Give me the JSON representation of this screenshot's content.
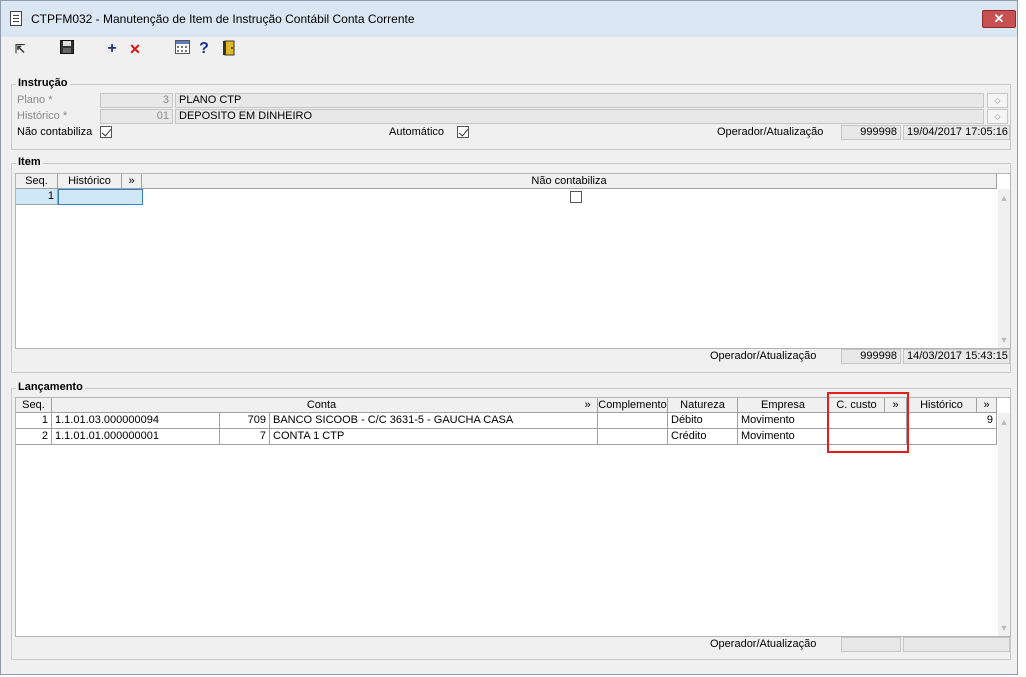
{
  "window": {
    "title": "CTPFM032 - Manutenção de Item de Instrução Contábil Conta Corrente",
    "close_glyph": "✕"
  },
  "toolbar": {
    "items": [
      {
        "name": "select-icon",
        "glyph": "⇱"
      },
      {
        "name": "save-icon",
        "glyph": "💾"
      },
      {
        "name": "add-icon",
        "glyph": "+"
      },
      {
        "name": "delete-icon",
        "glyph": "✕"
      },
      {
        "name": "calculator-icon",
        "glyph": "▦"
      },
      {
        "name": "help-icon",
        "glyph": "?"
      },
      {
        "name": "exit-icon",
        "glyph": "⎘"
      }
    ]
  },
  "instrucao": {
    "title": "Instrução",
    "plano_label": "Plano *",
    "plano_code": "3",
    "plano_desc": "PLANO CTP",
    "historico_label": "Histórico *",
    "historico_code": "01",
    "historico_desc": "DEPOSITO EM DINHEIRO",
    "nao_contabiliza_label": "Não contabiliza",
    "nao_contabiliza_checked": true,
    "automatico_label": "Automático",
    "automatico_checked": true,
    "operador_label": "Operador/Atualização",
    "operador": "999998",
    "atualizacao": "19/04/2017 17:05:16"
  },
  "item": {
    "title": "Item",
    "columns": {
      "seq": "Seq.",
      "historico": "Histórico",
      "expand": "»",
      "nao_contabiliza": "Não contabiliza"
    },
    "rows": [
      {
        "seq": "1",
        "historico": "",
        "nao_contabiliza": false
      }
    ],
    "operador_label": "Operador/Atualização",
    "operador": "999998",
    "atualizacao": "14/03/2017 15:43:15"
  },
  "lancamento": {
    "title": "Lançamento",
    "columns": {
      "seq": "Seq.",
      "conta": "Conta",
      "expand1": "»",
      "complemento": "Complemento",
      "natureza": "Natureza",
      "empresa": "Empresa",
      "ccusto": "C. custo",
      "expand2": "»",
      "historico": "Histórico",
      "expand3": "»"
    },
    "rows": [
      {
        "seq": "1",
        "conta": "1.1.01.03.000000094",
        "num": "709",
        "desc": "BANCO SICOOB - C/C 3631-5 - GAUCHA CASA",
        "complemento": "",
        "natureza": "Débito",
        "empresa": "Movimento",
        "ccusto": "",
        "historico": "9"
      },
      {
        "seq": "2",
        "conta": "1.1.01.01.000000001",
        "num": "7",
        "desc": "CONTA 1 CTP",
        "complemento": "",
        "natureza": "Crédito",
        "empresa": "Movimento",
        "ccusto": "",
        "historico": ""
      }
    ],
    "operador_label": "Operador/Atualização",
    "operador": "",
    "atualizacao": ""
  }
}
